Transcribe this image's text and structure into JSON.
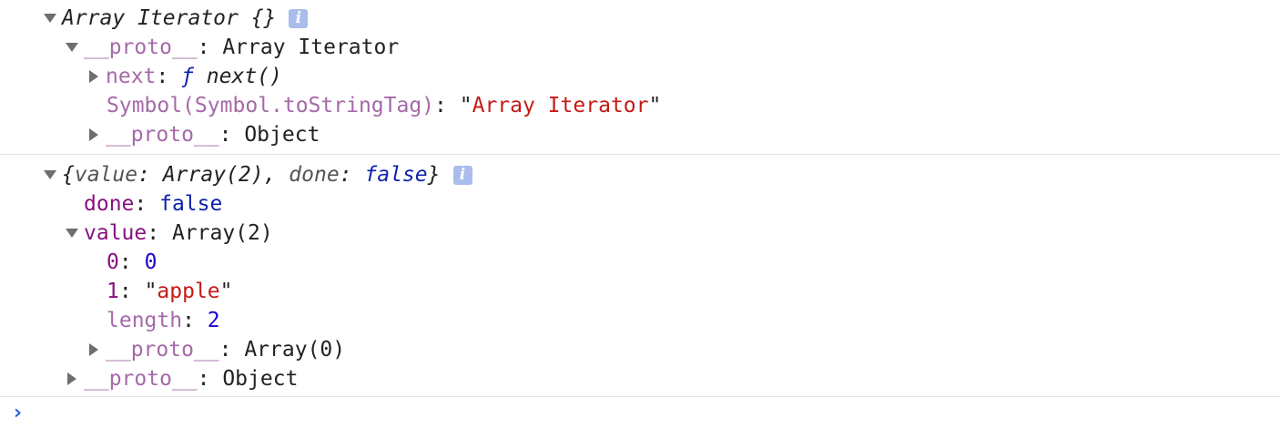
{
  "entries": [
    {
      "title": "Array Iterator {}",
      "info_icon": "i",
      "rows": {
        "proto_key": "__proto__",
        "proto_sep": ": ",
        "proto_value": "Array Iterator",
        "next_key": "next",
        "next_sep": ": ",
        "next_f": "ƒ",
        "next_value": " next()",
        "symbol_key": "Symbol(Symbol.toStringTag)",
        "symbol_sep": ": ",
        "symbol_quote_open": "\"",
        "symbol_value": "Array Iterator",
        "symbol_quote_close": "\"",
        "proto2_key": "__proto__",
        "proto2_sep": ": ",
        "proto2_value": "Object"
      }
    },
    {
      "preview_open": "{",
      "preview_value_key": "value",
      "preview_sep1": ": ",
      "preview_value_val": "Array(2)",
      "preview_comma": ", ",
      "preview_done_key": "done",
      "preview_sep2": ": ",
      "preview_done_val": "false",
      "preview_close": "}",
      "info_icon": "i",
      "rows": {
        "done_key": "done",
        "done_sep": ": ",
        "done_value": "false",
        "value_key": "value",
        "value_sep": ": ",
        "value_value": "Array(2)",
        "idx0_key": "0",
        "idx0_sep": ": ",
        "idx0_value": "0",
        "idx1_key": "1",
        "idx1_sep": ": ",
        "idx1_quote_open": "\"",
        "idx1_value": "apple",
        "idx1_quote_close": "\"",
        "length_key": "length",
        "length_sep": ": ",
        "length_value": "2",
        "arrproto_key": "__proto__",
        "arrproto_sep": ": ",
        "arrproto_value": "Array(0)",
        "objproto_key": "__proto__",
        "objproto_sep": ": ",
        "objproto_value": "Object"
      }
    }
  ],
  "prompt": {
    "icon": "›",
    "input_value": ""
  },
  "colors": {
    "key": "#881280",
    "key_dim": "#a56aa8",
    "string": "#c41a16",
    "number": "#1c00cf",
    "keyword": "#0d22aa",
    "info_badge": "#a9bcec",
    "prompt": "#2a63d8"
  }
}
